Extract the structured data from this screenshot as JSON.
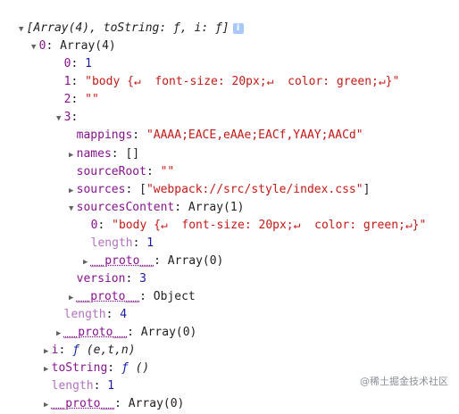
{
  "summary": "[Array(4), toString: ƒ, i: ƒ]",
  "info_badge": "i",
  "item0": {
    "key": "0",
    "type": "Array(4)"
  },
  "item0_0": {
    "key": "0",
    "value": "1"
  },
  "item0_1": {
    "key": "1",
    "value": "\"body {↵  font-size: 20px;↵  color: green;↵}\" "
  },
  "item0_2": {
    "key": "2",
    "value": "\"\""
  },
  "item0_3": {
    "key": "3"
  },
  "mappings": {
    "key": "mappings",
    "value": "\"AAAA;EACE,eAAe;EACf,YAAY;AACd\""
  },
  "names": {
    "key": "names",
    "value": "[]"
  },
  "sourceRoot": {
    "key": "sourceRoot",
    "value": "\"\""
  },
  "sources": {
    "key": "sources",
    "open": "[",
    "value": "\"webpack://src/style/index.css\"",
    "close": "]"
  },
  "sourcesContent": {
    "key": "sourcesContent",
    "type": "Array(1)"
  },
  "sc_0": {
    "key": "0",
    "value": "\"body {↵  font-size: 20px;↵  color: green;↵}\" "
  },
  "sc_length": {
    "key": "length",
    "value": "1"
  },
  "sc_proto": {
    "key": "__proto__",
    "value": "Array(0)"
  },
  "version": {
    "key": "version",
    "value": "3"
  },
  "item3_proto": {
    "key": "__proto__",
    "value": "Object"
  },
  "item0_length": {
    "key": "length",
    "value": "4"
  },
  "item0_proto": {
    "key": "__proto__",
    "value": "Array(0)"
  },
  "i_fn": {
    "key": "i",
    "f": "ƒ",
    "sig": "(e,t,n)"
  },
  "toString_fn": {
    "key": "toString",
    "f": "ƒ",
    "sig": "()"
  },
  "root_length": {
    "key": "length",
    "value": "1"
  },
  "root_proto": {
    "key": "__proto__",
    "value": "Array(0)"
  },
  "sep": ": ",
  "watermark": "@稀土掘金技术社区"
}
